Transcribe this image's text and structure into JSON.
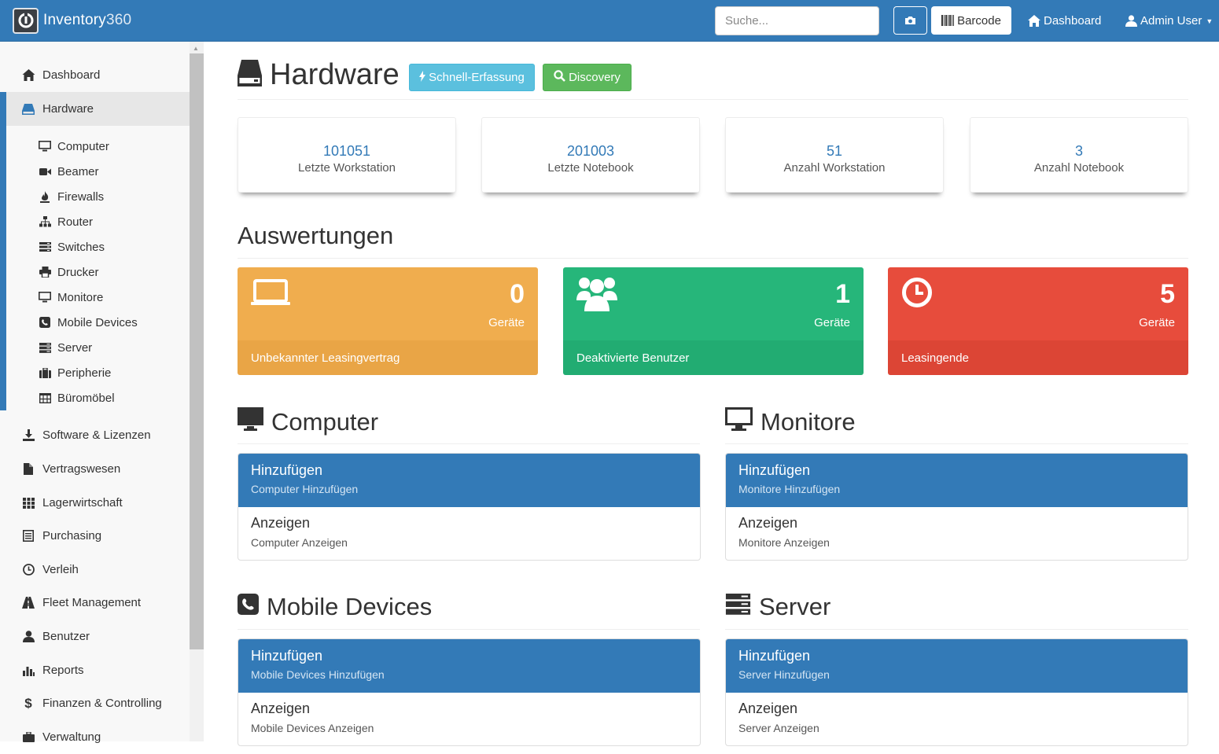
{
  "brand": {
    "name": "Inventory",
    "suffix": "360"
  },
  "navbar": {
    "search_placeholder": "Suche...",
    "barcode_label": "Barcode",
    "dashboard_label": "Dashboard",
    "user_label": "Admin User"
  },
  "sidebar": {
    "items": [
      {
        "label": "Dashboard",
        "icon": "home-icon"
      },
      {
        "label": "Hardware",
        "icon": "hdd-icon"
      },
      {
        "label": "Software & Lizenzen",
        "icon": "download-icon"
      },
      {
        "label": "Vertragswesen",
        "icon": "file-icon"
      },
      {
        "label": "Lagerwirtschaft",
        "icon": "grid-icon"
      },
      {
        "label": "Purchasing",
        "icon": "list-alt-icon"
      },
      {
        "label": "Verleih",
        "icon": "clock-icon"
      },
      {
        "label": "Fleet Management",
        "icon": "road-icon"
      },
      {
        "label": "Benutzer",
        "icon": "user-icon"
      },
      {
        "label": "Reports",
        "icon": "stats-icon"
      },
      {
        "label": "Finanzen & Controlling",
        "icon": "dollar-icon"
      },
      {
        "label": "Verwaltung",
        "icon": "briefcase-icon"
      }
    ],
    "sub_items": [
      {
        "label": "Computer",
        "icon": "monitor-icon"
      },
      {
        "label": "Beamer",
        "icon": "camera-icon"
      },
      {
        "label": "Firewalls",
        "icon": "fire-icon"
      },
      {
        "label": "Router",
        "icon": "sitemap-icon"
      },
      {
        "label": "Switches",
        "icon": "tasks-icon"
      },
      {
        "label": "Drucker",
        "icon": "print-icon"
      },
      {
        "label": "Monitore",
        "icon": "monitor-icon"
      },
      {
        "label": "Mobile Devices",
        "icon": "phone-icon"
      },
      {
        "label": "Server",
        "icon": "server-icon"
      },
      {
        "label": "Peripherie",
        "icon": "briefcase-icon"
      },
      {
        "label": "Büromöbel",
        "icon": "table-icon"
      }
    ]
  },
  "page": {
    "title": "Hardware",
    "quick_button": "Schnell-Erfassung",
    "discovery_button": "Discovery"
  },
  "stats": [
    {
      "value": "101051",
      "label": "Letzte Workstation"
    },
    {
      "value": "201003",
      "label": "Letzte Notebook"
    },
    {
      "value": "51",
      "label": "Anzahl Workstation"
    },
    {
      "value": "3",
      "label": "Anzahl Notebook"
    }
  ],
  "evaluations": {
    "title": "Auswertungen",
    "panels": [
      {
        "count": "0",
        "unit": "Geräte",
        "label": "Unbekannter Leasingvertrag",
        "color": "#f0ad4e",
        "icon": "laptop-icon"
      },
      {
        "count": "1",
        "unit": "Geräte",
        "label": "Deaktivierte Benutzer",
        "color": "#26b67a",
        "icon": "users-icon"
      },
      {
        "count": "5",
        "unit": "Geräte",
        "label": "Leasingende",
        "color": "#e74c3c",
        "icon": "clock-icon"
      }
    ]
  },
  "sections": [
    {
      "title": "Computer",
      "add": "Hinzufügen",
      "add_sub": "Computer Hinzufügen",
      "show": "Anzeigen",
      "show_sub": "Computer Anzeigen"
    },
    {
      "title": "Monitore",
      "add": "Hinzufügen",
      "add_sub": "Monitore Hinzufügen",
      "show": "Anzeigen",
      "show_sub": "Monitore Anzeigen"
    },
    {
      "title": "Mobile Devices",
      "add": "Hinzufügen",
      "add_sub": "Mobile Devices Hinzufügen",
      "show": "Anzeigen",
      "show_sub": "Mobile Devices Anzeigen"
    },
    {
      "title": "Server",
      "add": "Hinzufügen",
      "add_sub": "Server Hinzufügen",
      "show": "Anzeigen",
      "show_sub": "Server Anzeigen"
    }
  ],
  "colors": {
    "primary": "#337ab7",
    "info": "#5bc0de",
    "success": "#5cb85c",
    "warning": "#f0ad4e",
    "green": "#26b67a",
    "danger": "#e74c3c"
  }
}
